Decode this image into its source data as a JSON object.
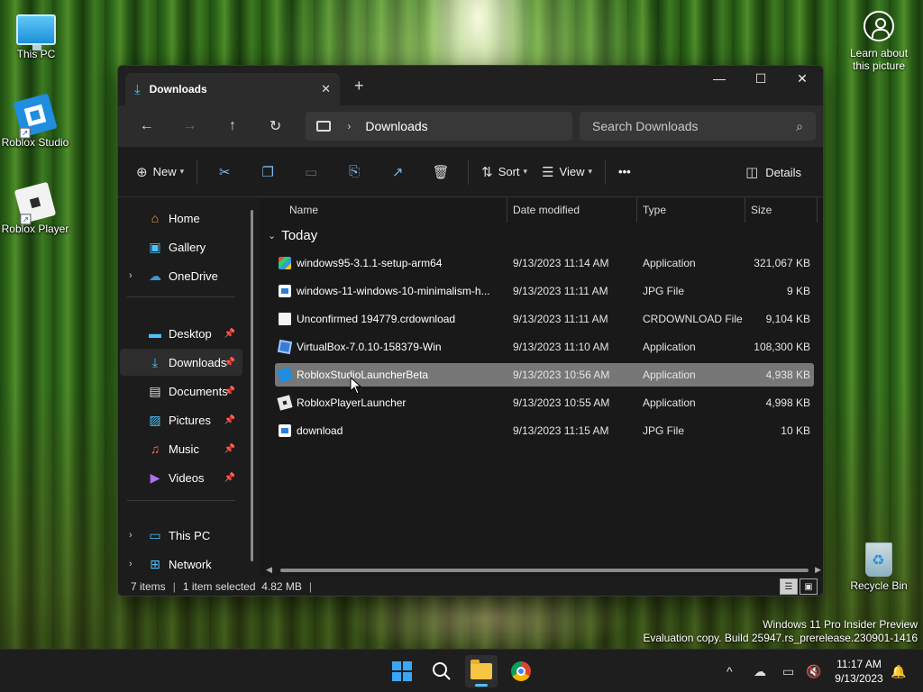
{
  "desktop": {
    "icons": [
      {
        "label": "This PC"
      },
      {
        "label": "Roblox Studio"
      },
      {
        "label": "Roblox Player"
      },
      {
        "label": "Recycle Bin"
      }
    ],
    "learn": {
      "line1": "Learn about",
      "line2": "this picture"
    },
    "watermark": {
      "line1": "Windows 11 Pro Insider Preview",
      "line2": "Evaluation copy. Build 25947.rs_prerelease.230901-1416"
    }
  },
  "window": {
    "tab_title": "Downloads",
    "tab_close": "✕",
    "new_tab": "+",
    "controls": {
      "minimize": "—",
      "maximize": "☐",
      "close": "✕"
    },
    "nav": {
      "back": "←",
      "forward": "→",
      "up": "↑",
      "refresh": "↻"
    },
    "breadcrumb": {
      "chevron": "›",
      "location": "Downloads"
    },
    "search": {
      "placeholder": "Search Downloads",
      "icon": "⌕"
    },
    "toolbar": {
      "new": "New",
      "sort": "Sort",
      "view": "View",
      "more": "•••",
      "details": "Details"
    },
    "nav_pane": [
      {
        "label": "Home",
        "icon": "home-icon"
      },
      {
        "label": "Gallery",
        "icon": "gallery-icon"
      },
      {
        "label": "OneDrive",
        "icon": "cloud-icon"
      },
      {
        "label": "Desktop",
        "icon": "desktop-icon"
      },
      {
        "label": "Downloads",
        "icon": "download-icon",
        "selected": true
      },
      {
        "label": "Documents",
        "icon": "documents-icon"
      },
      {
        "label": "Pictures",
        "icon": "pictures-icon"
      },
      {
        "label": "Music",
        "icon": "music-icon"
      },
      {
        "label": "Videos",
        "icon": "videos-icon"
      },
      {
        "label": "This PC",
        "icon": "pc-icon"
      },
      {
        "label": "Network",
        "icon": "network-icon"
      }
    ],
    "columns": {
      "name": "Name",
      "date": "Date modified",
      "type": "Type",
      "size": "Size"
    },
    "group": "Today",
    "files": [
      {
        "name": "windows95-3.1.1-setup-arm64",
        "date": "9/13/2023 11:14 AM",
        "type": "Application",
        "size": "321,067 KB"
      },
      {
        "name": "windows-11-windows-10-minimalism-h...",
        "date": "9/13/2023 11:11 AM",
        "type": "JPG File",
        "size": "9 KB"
      },
      {
        "name": "Unconfirmed 194779.crdownload",
        "date": "9/13/2023 11:11 AM",
        "type": "CRDOWNLOAD File",
        "size": "9,104 KB"
      },
      {
        "name": "VirtualBox-7.0.10-158379-Win",
        "date": "9/13/2023 11:10 AM",
        "type": "Application",
        "size": "108,300 KB"
      },
      {
        "name": "RobloxStudioLauncherBeta",
        "date": "9/13/2023 10:56 AM",
        "type": "Application",
        "size": "4,938 KB",
        "selected": true
      },
      {
        "name": "RobloxPlayerLauncher",
        "date": "9/13/2023 10:55 AM",
        "type": "Application",
        "size": "4,998 KB"
      },
      {
        "name": "download",
        "date": "9/13/2023 11:15 AM",
        "type": "JPG File",
        "size": "10 KB"
      }
    ],
    "status": {
      "count": "7 items",
      "selection": "1 item selected  4.82 MB",
      "sep": "|"
    }
  },
  "taskbar": {
    "clock": {
      "time": "11:17 AM",
      "date": "9/13/2023"
    },
    "tray_chevron": "^"
  },
  "colors": {
    "accent": "#4cc2ff",
    "selected_row": "#777777",
    "window_bg": "#191919"
  }
}
